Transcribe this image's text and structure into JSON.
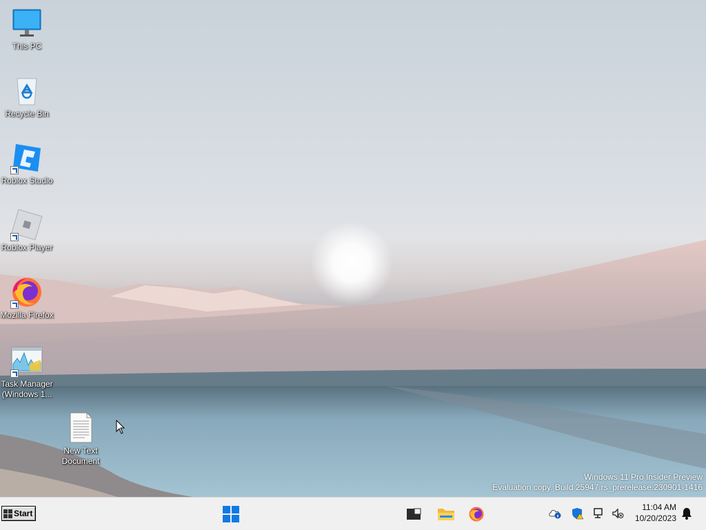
{
  "desktop_icons": [
    {
      "label": "This PC"
    },
    {
      "label": "Recycle Bin"
    },
    {
      "label": "Roblox Studio"
    },
    {
      "label": "Roblox Player"
    },
    {
      "label": "Mozilla Firefox"
    },
    {
      "label": "Task Manager (Windows 1..."
    },
    {
      "label": "New Text Document"
    }
  ],
  "watermark": {
    "line1": "Windows 11 Pro Insider Preview",
    "line2": "Evaluation copy. Build 25947.rs_prerelease.230901-1416"
  },
  "taskbar": {
    "start_label": "Start",
    "time": "11:04 AM",
    "date": "10/20/2023"
  }
}
